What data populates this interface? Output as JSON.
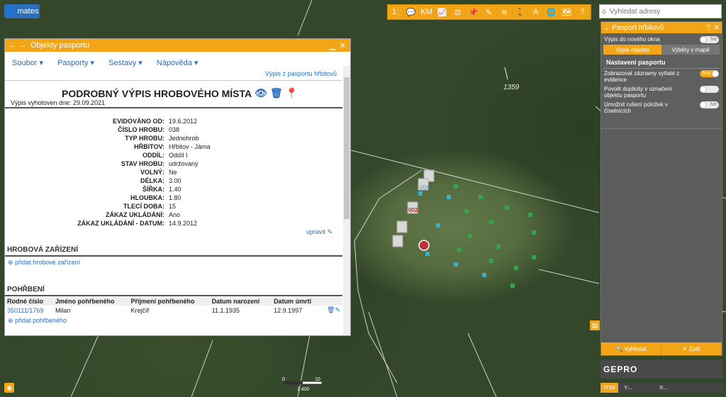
{
  "user": {
    "name": "mates"
  },
  "toolbar": {
    "tools": [
      {
        "name": "ruler-icon",
        "glyph": "1:"
      },
      {
        "name": "comment-icon",
        "glyph": "💬"
      },
      {
        "name": "km-icon",
        "glyph": "KM"
      },
      {
        "name": "chart-icon",
        "glyph": "📈"
      },
      {
        "name": "measure-icon",
        "glyph": "⚖"
      },
      {
        "name": "pin-icon",
        "glyph": "📌"
      },
      {
        "name": "pencil-icon",
        "glyph": "✎"
      },
      {
        "name": "layers-icon",
        "glyph": "≋"
      },
      {
        "name": "person-icon",
        "glyph": "🚶"
      },
      {
        "name": "text-icon",
        "glyph": "A"
      },
      {
        "name": "globe-icon",
        "glyph": "🌐"
      },
      {
        "name": "map-icon",
        "glyph": "🗺"
      },
      {
        "name": "help-icon",
        "glyph": "?"
      }
    ]
  },
  "search": {
    "placeholder": "Vyhledat adresy"
  },
  "window": {
    "title": "Objekty pasportu",
    "menu": [
      "Soubor ▾",
      "Pasporty ▾",
      "Sestavy ▾",
      "Nápověda ▾"
    ],
    "report_link": "Výpis z pasportu hřbitovů",
    "heading": "PODROBNÝ VÝPIS HROBOVÉHO MÍSTA",
    "date_line": "Výpis vyhotoven dne: 29.09.2021",
    "fields": [
      {
        "label": "EVIDOVÁNO OD:",
        "value": "19.6.2012"
      },
      {
        "label": "ČÍSLO HROBU:",
        "value": "038"
      },
      {
        "label": "TYP HROBU:",
        "value": "Jednohrob"
      },
      {
        "label": "HŘBITOV:",
        "value": "Hřbitov - Jáma"
      },
      {
        "label": "ODDÍL:",
        "value": "Oddíl I"
      },
      {
        "label": "STAV HROBU:",
        "value": "udržovaný"
      },
      {
        "label": "VOLNÝ:",
        "value": "Ne"
      },
      {
        "label": "DÉLKA:",
        "value": "3.00"
      },
      {
        "label": "ŠÍŘKA:",
        "value": "1.40"
      },
      {
        "label": "HLOUBKA:",
        "value": "1.80"
      },
      {
        "label": "TLECÍ DOBA:",
        "value": "15"
      },
      {
        "label": "ZÁKAZ UKLÁDÁNÍ:",
        "value": "Ano"
      },
      {
        "label": "ZÁKAZ UKLÁDÁNÍ - DATUM:",
        "value": "14.9.2012"
      }
    ],
    "edit_link": "upravit",
    "section_equipment": "HROBOVÁ ZAŘÍZENÍ",
    "add_equipment": "přidat hrobové zařízení",
    "section_burials": "POHŘBENÍ",
    "burial_headers": [
      "Rodné číslo",
      "Jméno pohřbeného",
      "Příjmení pohřbeného",
      "Datum narození",
      "Datum úmrtí"
    ],
    "burials": [
      {
        "rc": "350111/1769",
        "first": "Milan",
        "last": "Krejčíř",
        "born": "11.1.1935",
        "died": "12.9.1997"
      }
    ],
    "add_burial": "přidat pohřbeného"
  },
  "right_panel": {
    "title": "Pasport hřbitovů",
    "new_window_label": "Výpis do nového okna",
    "new_window_value": "Ne",
    "tabs": [
      "Výpis objektu",
      "Výběry v mapě"
    ],
    "section": "Nastavení pasportu",
    "settings": [
      {
        "label": "Zobrazovat záznamy vyňaté z evidence",
        "value": "Ano",
        "on": true
      },
      {
        "label": "Povolit duplicity v označení objektu pasportu",
        "value": "",
        "on": false
      },
      {
        "label": "Umožnit rušení položek v číselnících",
        "value": "Ne",
        "on": false
      }
    ],
    "search_button": "Vyhledat",
    "back_button": "Zpět"
  },
  "map": {
    "elevation": "1359",
    "labels": [
      "002",
      "004"
    ],
    "scale": {
      "zero": "0",
      "ten": "10",
      "ratio": "1:400"
    },
    "logo": "GEPRO",
    "coords": {
      "system": "JTSK",
      "y": "Y:...",
      "x": "X:..."
    }
  },
  "colors": {
    "accent": "#f2a516",
    "link": "#2a6ebd"
  }
}
